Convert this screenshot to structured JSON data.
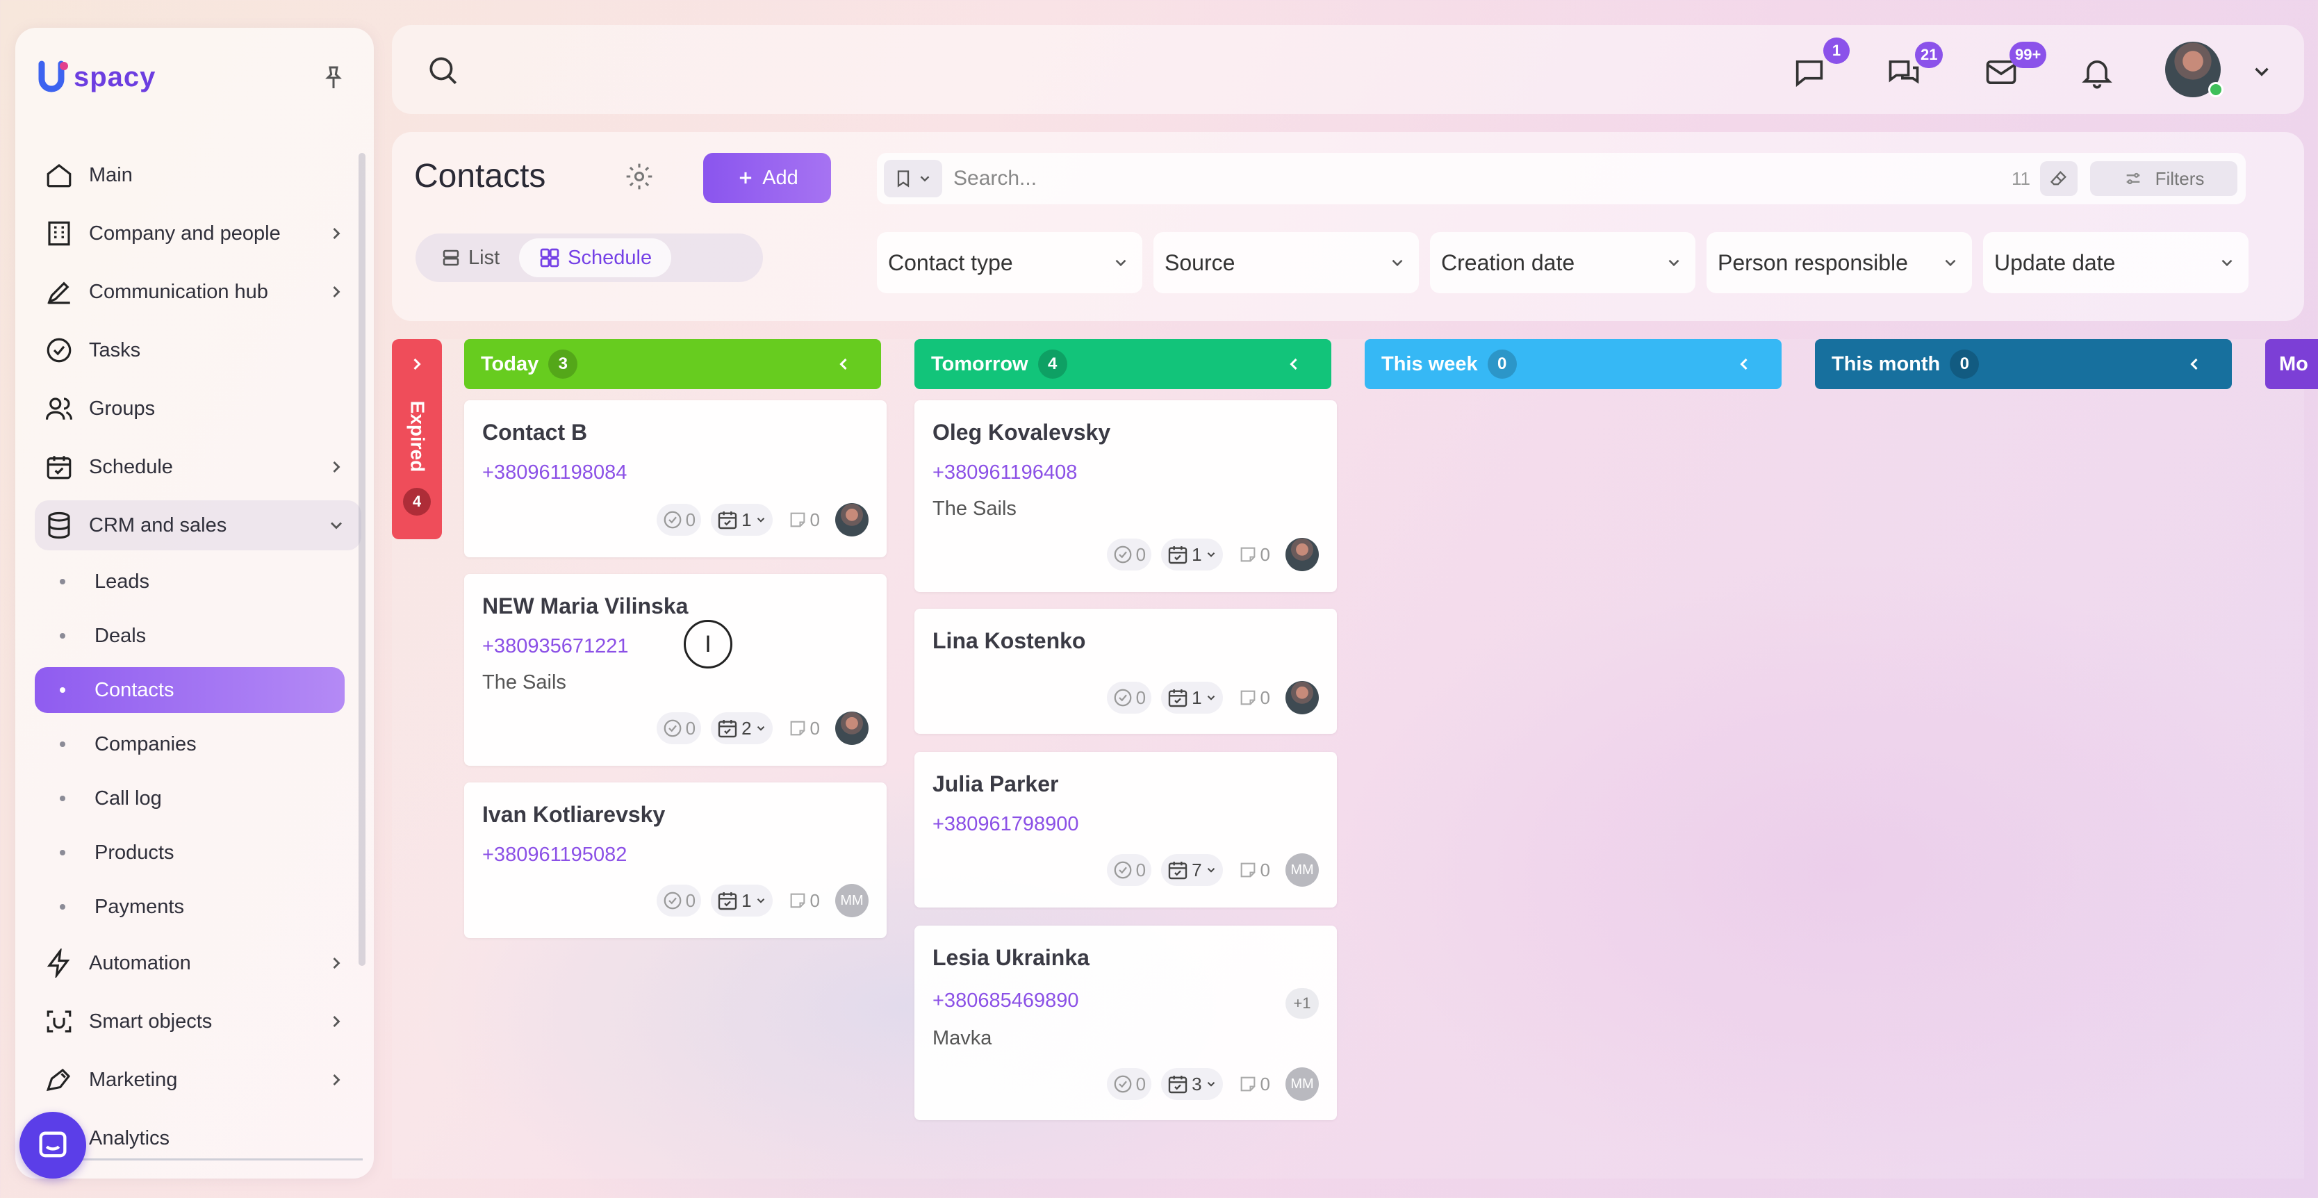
{
  "brand": {
    "name": "spacy",
    "accent": "#8b52ea"
  },
  "sidebar": {
    "items": [
      {
        "label": "Main",
        "icon": "home-icon",
        "has_chevron": false
      },
      {
        "label": "Company and people",
        "icon": "building-icon",
        "has_chevron": true
      },
      {
        "label": "Communication hub",
        "icon": "edit-chat-icon",
        "has_chevron": true
      },
      {
        "label": "Tasks",
        "icon": "check-circle-icon",
        "has_chevron": false
      },
      {
        "label": "Groups",
        "icon": "users-icon",
        "has_chevron": false
      },
      {
        "label": "Schedule",
        "icon": "calendar-icon",
        "has_chevron": true
      },
      {
        "label": "CRM and sales",
        "icon": "database-icon",
        "has_chevron": true,
        "open": true
      }
    ],
    "sub_items": [
      {
        "label": "Leads"
      },
      {
        "label": "Deals"
      },
      {
        "label": "Contacts",
        "active": true
      },
      {
        "label": "Companies"
      },
      {
        "label": "Call log"
      },
      {
        "label": "Products"
      },
      {
        "label": "Payments"
      }
    ],
    "bottom_items": [
      {
        "label": "Automation",
        "icon": "bolt-icon"
      },
      {
        "label": "Smart objects",
        "icon": "scan-icon"
      },
      {
        "label": "Marketing",
        "icon": "megaphone-icon"
      },
      {
        "label": "Analytics",
        "icon": "chart-icon"
      }
    ]
  },
  "topbar": {
    "badges": {
      "messages": "1",
      "chats": "21",
      "mail": "99+"
    }
  },
  "header": {
    "title": "Contacts",
    "add_label": "Add",
    "view_list": "List",
    "view_schedule": "Schedule",
    "search_placeholder": "Search...",
    "search_count": "11",
    "filters_label": "Filters",
    "filter_dropdowns": [
      "Contact type",
      "Source",
      "Creation date",
      "Person responsible",
      "Update date"
    ]
  },
  "board": {
    "expired": {
      "label": "Expired",
      "count": "4",
      "color": "#ef4d5a"
    },
    "columns": [
      {
        "title": "Today",
        "count": "3",
        "color": "#67cc1f"
      },
      {
        "title": "Tomorrow",
        "count": "4",
        "color": "#12c47a"
      },
      {
        "title": "This week",
        "count": "0",
        "color": "#36b8f5"
      },
      {
        "title": "This month",
        "count": "0",
        "color": "#17709e"
      },
      {
        "title": "Mo",
        "color": "#7c3fd6"
      }
    ],
    "today_cards": [
      {
        "name": "Contact B",
        "phone": "+380961198084",
        "company": "",
        "tasks": "0",
        "events": "1",
        "notes": "0",
        "avatar": "photo"
      },
      {
        "name": "NEW Maria Vilinska",
        "phone": "+380935671221",
        "company": "The Sails",
        "tasks": "0",
        "events": "2",
        "notes": "0",
        "avatar": "photo"
      },
      {
        "name": "Ivan Kotliarevsky",
        "phone": "+380961195082",
        "company": "",
        "tasks": "0",
        "events": "1",
        "notes": "0",
        "avatar": "MM"
      }
    ],
    "tomorrow_cards": [
      {
        "name": "Oleg Kovalevsky",
        "phone": "+380961196408",
        "company": "The Sails",
        "tasks": "0",
        "events": "1",
        "notes": "0",
        "avatar": "photo"
      },
      {
        "name": "Lina Kostenko",
        "phone": "",
        "company": "",
        "tasks": "0",
        "events": "1",
        "notes": "0",
        "avatar": "photo"
      },
      {
        "name": "Julia Parker",
        "phone": "+380961798900",
        "company": "",
        "tasks": "0",
        "events": "7",
        "notes": "0",
        "avatar": "MM"
      },
      {
        "name": "Lesia Ukrainka",
        "phone": "+380685469890",
        "company": "Mavka",
        "extra": "+1",
        "tasks": "0",
        "events": "3",
        "notes": "0",
        "avatar": "MM"
      }
    ]
  }
}
